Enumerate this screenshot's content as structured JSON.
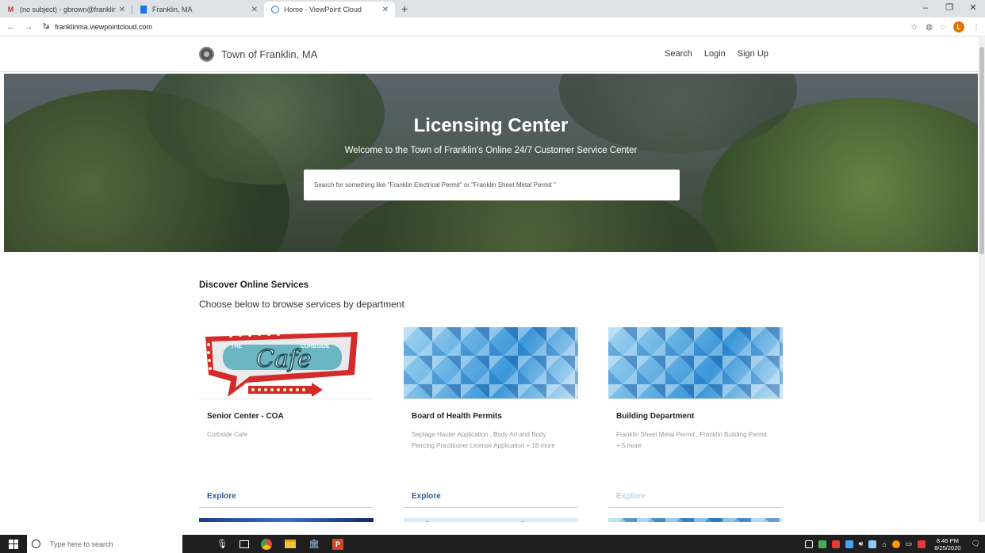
{
  "browser": {
    "tabs": [
      {
        "title": "(no subject) - gbrown@franklinm",
        "icon": "gmail-icon",
        "active": false
      },
      {
        "title": "Franklin, MA",
        "icon": "doc-icon",
        "active": false
      },
      {
        "title": "Home - ViewPoint Cloud",
        "icon": "viewpoint-icon",
        "active": true
      }
    ],
    "new_tab": "+",
    "url": "franklinma.viewpointcloud.com",
    "profile_initial": "L"
  },
  "site": {
    "brand": "Town of Franklin, MA",
    "nav": [
      "Search",
      "Login",
      "Sign Up"
    ]
  },
  "hero": {
    "title": "Licensing Center",
    "subtitle": "Welcome to the Town of Franklin's Online 24/7 Customer Service Center",
    "search_placeholder": "Search for something like \"Franklin Electrical Permit\" or \"Franklin Sheet Metal Permit \""
  },
  "discover": {
    "title": "Discover Online Services",
    "subtitle": "Choose below to browse services by department"
  },
  "cards": [
    {
      "title": "Senior Center - COA",
      "desc": "Curbside Cafe",
      "explore": "Explore",
      "image_text_1": "THE",
      "image_text_2": "CURBSIDE",
      "image_text_3": "Cafe"
    },
    {
      "title": "Board of Health Permits",
      "desc": "Septage Hauler Application , Body Art and Body Piercing Practitioner License Application + 18 more",
      "explore": "Explore"
    },
    {
      "title": "Building Department",
      "desc": "Franklin Sheet Metal Permit , Franklin Building Permit + 5 more",
      "explore": "Explore"
    }
  ],
  "taskbar": {
    "search_placeholder": "Type here to search",
    "time": "8:46 PM",
    "date": "8/25/2020"
  }
}
